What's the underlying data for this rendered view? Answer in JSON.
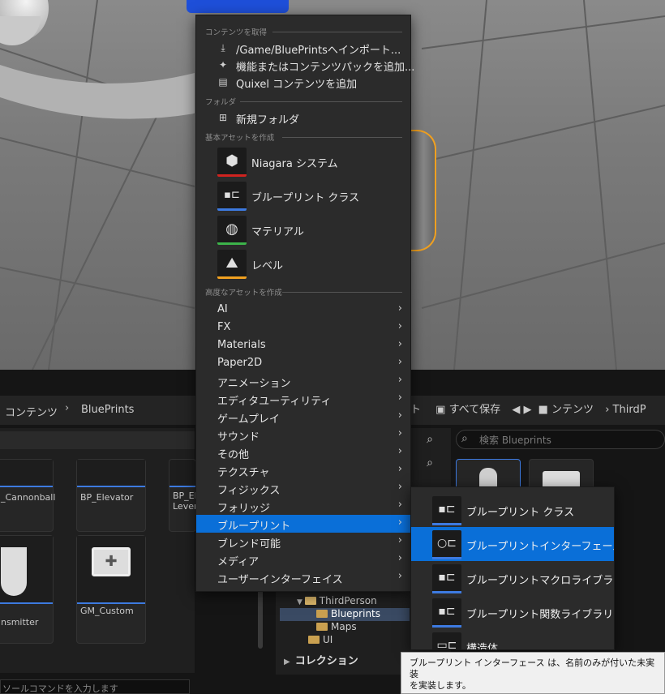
{
  "menu": {
    "sections": {
      "get_content": "コンテンツを取得",
      "folder": "フォルダ",
      "basic_assets": "基本アセットを作成",
      "advanced_assets": "高度なアセットを作成"
    },
    "get_content_items": [
      {
        "label": "/Game/BluePrintsへインポート...",
        "icon": "import-icon"
      },
      {
        "label": "機能またはコンテンツパックを追加...",
        "icon": "add-feature-icon"
      },
      {
        "label": "Quixel コンテンツを追加",
        "icon": "quixel-icon"
      }
    ],
    "folder_items": [
      {
        "label": "新規フォルダ",
        "icon": "new-folder-icon"
      }
    ],
    "basic_assets": [
      {
        "label": "Niagara システム",
        "icon": "niagara-icon",
        "color": "#d0231f"
      },
      {
        "label": "ブループリント クラス",
        "icon": "blueprint-class-icon",
        "color": "#3d7ae0"
      },
      {
        "label": "マテリアル",
        "icon": "material-icon",
        "color": "#3db34a"
      },
      {
        "label": "レベル",
        "icon": "level-icon",
        "color": "#f0a020"
      }
    ],
    "advanced_assets": [
      {
        "label": "AI"
      },
      {
        "label": "FX"
      },
      {
        "label": "Materials"
      },
      {
        "label": "Paper2D"
      },
      {
        "label": "アニメーション"
      },
      {
        "label": "エディタユーティリティ"
      },
      {
        "label": "ゲームプレイ"
      },
      {
        "label": "サウンド"
      },
      {
        "label": "その他"
      },
      {
        "label": "テクスチャ"
      },
      {
        "label": "フィジックス"
      },
      {
        "label": "フォリッジ"
      },
      {
        "label": "ブループリント",
        "active": true
      },
      {
        "label": "ブレンド可能"
      },
      {
        "label": "メディア"
      },
      {
        "label": "ユーザーインターフェイス"
      }
    ]
  },
  "submenu": {
    "items": [
      {
        "label": "ブループリント クラス",
        "icon": "blueprint-class-icon"
      },
      {
        "label": "ブループリントインターフェース",
        "icon": "blueprint-interface-icon",
        "active": true
      },
      {
        "label": "ブループリントマクロライブラリ",
        "icon": "blueprint-macro-icon"
      },
      {
        "label": "ブループリント関数ライブラリ",
        "icon": "blueprint-function-icon"
      },
      {
        "label": "構造体",
        "icon": "struct-icon"
      }
    ]
  },
  "tooltip": {
    "line1": "ブループリント インターフェース は、名前のみが付いた未実装",
    "line2": "を実装します。"
  },
  "content_browser": {
    "breadcrumb_left": [
      "コンテンツ",
      "BluePrints"
    ],
    "right_toolbar": {
      "tail": "ト",
      "save_all": "すべて保存",
      "content": "ンテンツ",
      "third": "ThirdP"
    },
    "search_placeholder": "検索 Blueprints",
    "assets_left": [
      {
        "label": "_Cannonball"
      },
      {
        "label": "BP_Elevator"
      },
      {
        "label": "BP_El",
        "label2": "Lever"
      },
      {
        "label": "nsmitter"
      },
      {
        "label": "GM_Custom"
      }
    ],
    "tree": [
      {
        "label": "ThirdPerson",
        "indent": 1
      },
      {
        "label": "Blueprints",
        "indent": 2,
        "selected": true
      },
      {
        "label": "Maps",
        "indent": 2
      },
      {
        "label": "UI",
        "indent": 1
      }
    ],
    "collections": "コレクション",
    "command_placeholder": "ソールコマンドを入力します"
  }
}
